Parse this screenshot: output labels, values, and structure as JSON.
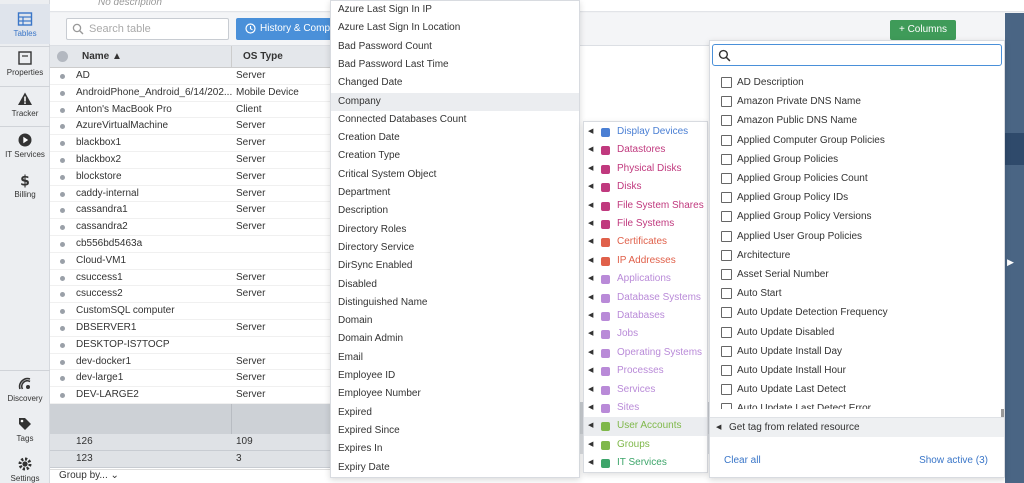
{
  "top": {
    "description": "No description"
  },
  "nav": {
    "items": [
      {
        "label": "Tables",
        "icon": "table-icon"
      },
      {
        "label": "Properties",
        "icon": "properties-icon"
      },
      {
        "label": "Tracker",
        "icon": "warning-icon"
      },
      {
        "label": "IT Services",
        "icon": "play-icon"
      },
      {
        "label": "Billing",
        "icon": "dollar-icon"
      },
      {
        "label": "Discovery",
        "icon": "radar-icon"
      },
      {
        "label": "Tags",
        "icon": "tag-icon"
      },
      {
        "label": "Settings",
        "icon": "gear-icon"
      }
    ]
  },
  "toolbar": {
    "search_placeholder": "Search table",
    "history_label": "History & Compa",
    "columns_label": "+ Columns"
  },
  "table": {
    "col_name": "Name ▲",
    "col_os": "OS Type",
    "rows": [
      {
        "name": "AD",
        "os": "Server"
      },
      {
        "name": "AndroidPhone_Android_6/14/202...",
        "os": "Mobile Device"
      },
      {
        "name": "Anton's MacBook Pro",
        "os": "Client"
      },
      {
        "name": "AzureVirtualMachine",
        "os": "Server"
      },
      {
        "name": "blackbox1",
        "os": "Server"
      },
      {
        "name": "blackbox2",
        "os": "Server"
      },
      {
        "name": "blockstore",
        "os": "Server"
      },
      {
        "name": "caddy-internal",
        "os": "Server"
      },
      {
        "name": "cassandra1",
        "os": "Server"
      },
      {
        "name": "cassandra2",
        "os": "Server"
      },
      {
        "name": "cb556bd5463a",
        "os": ""
      },
      {
        "name": "Cloud-VM1",
        "os": ""
      },
      {
        "name": "csuccess1",
        "os": "Server"
      },
      {
        "name": "csuccess2",
        "os": "Server"
      },
      {
        "name": "CustomSQL computer",
        "os": ""
      },
      {
        "name": "DBSERVER1",
        "os": "Server"
      },
      {
        "name": "DESKTOP-IS7TOCP",
        "os": ""
      },
      {
        "name": "dev-docker1",
        "os": "Server"
      },
      {
        "name": "dev-large1",
        "os": "Server"
      },
      {
        "name": "DEV-LARGE2",
        "os": "Server"
      }
    ],
    "summary": [
      {
        "a": "126",
        "b": "109"
      },
      {
        "a": "123",
        "b": "3"
      }
    ],
    "group_by": "Group by... ⌄"
  },
  "attributes": {
    "items": [
      "Azure Last Sign In IP",
      "Azure Last Sign In Location",
      "Bad Password Count",
      "Bad Password Last Time",
      "Changed Date",
      "Company",
      "Connected Databases Count",
      "Creation Date",
      "Creation Type",
      "Critical System Object",
      "Department",
      "Description",
      "Directory Roles",
      "Directory Service",
      "DirSync Enabled",
      "Disabled",
      "Distinguished Name",
      "Domain",
      "Domain Admin",
      "Email",
      "Employee ID",
      "Employee Number",
      "Expired",
      "Expired Since",
      "Expires In",
      "Expiry Date"
    ],
    "highlighted": "Company"
  },
  "categories": {
    "items": [
      {
        "label": "Display Devices",
        "color": "#4a7fd4"
      },
      {
        "label": "Datastores",
        "color": "#c0397e"
      },
      {
        "label": "Physical Disks",
        "color": "#c0397e"
      },
      {
        "label": "Disks",
        "color": "#c0397e"
      },
      {
        "label": "File System Shares",
        "color": "#c0397e"
      },
      {
        "label": "File Systems",
        "color": "#c0397e"
      },
      {
        "label": "Certificates",
        "color": "#e0604a"
      },
      {
        "label": "IP Addresses",
        "color": "#e0604a"
      },
      {
        "label": "Applications",
        "color": "#b98ad8"
      },
      {
        "label": "Database Systems",
        "color": "#b98ad8"
      },
      {
        "label": "Databases",
        "color": "#b98ad8"
      },
      {
        "label": "Jobs",
        "color": "#b98ad8"
      },
      {
        "label": "Operating Systems",
        "color": "#b98ad8"
      },
      {
        "label": "Processes",
        "color": "#b98ad8"
      },
      {
        "label": "Services",
        "color": "#b98ad8"
      },
      {
        "label": "Sites",
        "color": "#b98ad8"
      },
      {
        "label": "User Accounts",
        "color": "#7fb84a"
      },
      {
        "label": "Groups",
        "color": "#7fb84a"
      },
      {
        "label": "IT Services",
        "color": "#3da56a"
      }
    ],
    "highlighted": "User Accounts"
  },
  "columns_panel": {
    "search_placeholder": "",
    "items": [
      "AD Description",
      "Amazon Private DNS Name",
      "Amazon Public DNS Name",
      "Applied Computer Group Policies",
      "Applied Group Policies",
      "Applied Group Policies Count",
      "Applied Group Policy IDs",
      "Applied Group Policy Versions",
      "Applied User Group Policies",
      "Architecture",
      "Asset Serial Number",
      "Auto Start",
      "Auto Update Detection Frequency",
      "Auto Update Disabled",
      "Auto Update Install Day",
      "Auto Update Install Hour",
      "Auto Update Last Detect",
      "Auto Update Last Detect Error"
    ],
    "related_label": "Get tag from related resource",
    "clear_label": "Clear all",
    "show_label": "Show active (3)"
  }
}
